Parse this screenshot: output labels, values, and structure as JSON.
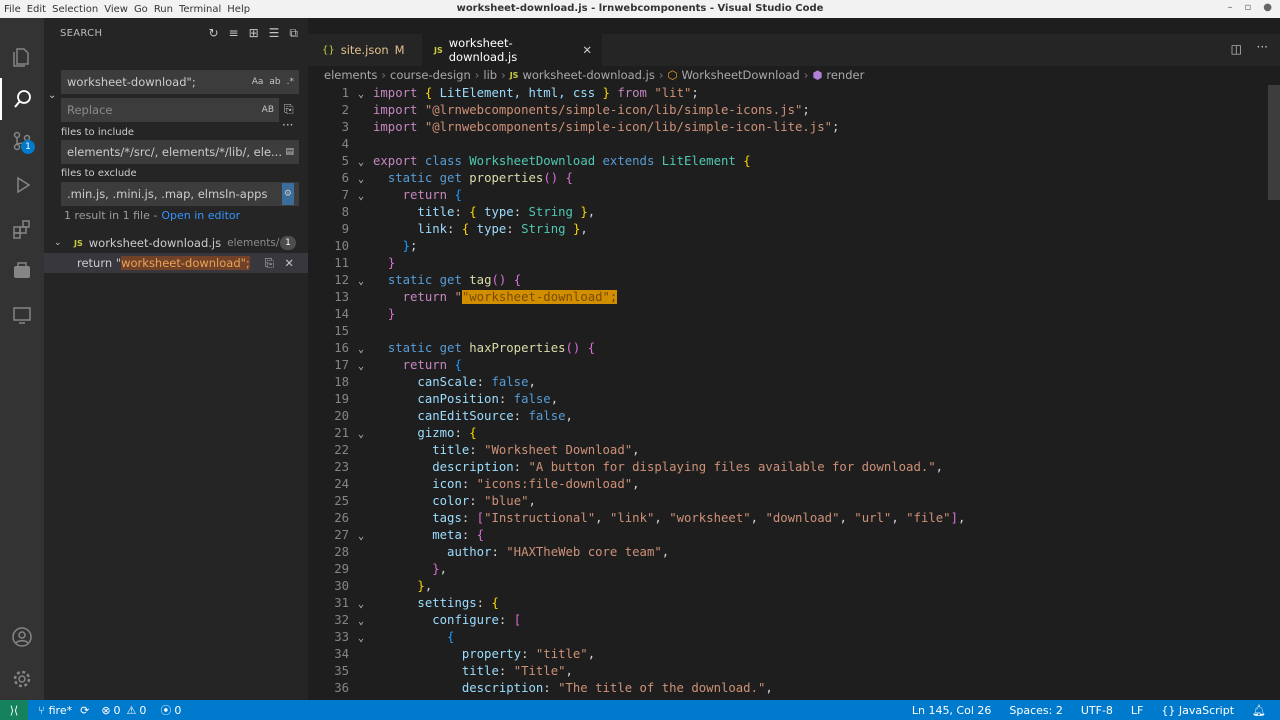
{
  "window": {
    "title": "worksheet-download.js - lrnwebcomponents - Visual Studio Code",
    "menu": [
      "File",
      "Edit",
      "Selection",
      "View",
      "Go",
      "Run",
      "Terminal",
      "Help"
    ]
  },
  "activity": {
    "scm_badge": "1"
  },
  "sidebar": {
    "header": "SEARCH",
    "search_value": "worksheet-download\";",
    "match_case": "Aa",
    "whole_word": "ab",
    "regex": ".*",
    "replace_placeholder": "Replace",
    "preserve_case": "AB",
    "include_label": "files to include",
    "include_value": "elements/*/src/, elements/*/lib/, ele...",
    "exclude_label": "files to exclude",
    "exclude_value": ".min.js, .mini.js, .map, elmsln-apps",
    "results_summary": "1 result in 1 file -",
    "open_in_editor": "Open in editor",
    "file_name": "worksheet-download.js",
    "file_path": "elements/...",
    "file_count": "1",
    "match_prefix": "return \"",
    "match_text": "worksheet-download\";"
  },
  "tabs": [
    {
      "icon": "{}",
      "label": "site.json",
      "status": "M"
    },
    {
      "icon": "JS",
      "label": "worksheet-download.js"
    }
  ],
  "breadcrumb": [
    "elements",
    "course-design",
    "lib",
    "worksheet-download.js",
    "WorksheetDownload",
    "render"
  ],
  "status": {
    "branch": "fire*",
    "errors": "0",
    "warnings": "0",
    "ports": "0",
    "position": "Ln 145, Col 26",
    "spaces": "Spaces: 2",
    "encoding": "UTF-8",
    "eol": "LF",
    "language": "JavaScript"
  },
  "code": {
    "l1_import": "import",
    "l1_names": "LitElement, html, css",
    "l1_from": "from",
    "l1_src": "\"lit\"",
    "l2_src": "\"@lrnwebcomponents/simple-icon/lib/simple-icons.js\"",
    "l3_src": "\"@lrnwebcomponents/simple-icon/lib/simple-icon-lite.js\"",
    "class_name": "WorksheetDownload",
    "extends_name": "LitElement",
    "type_name": "String",
    "tag_value": "\"worksheet-download\";",
    "gizmo_title": "\"Worksheet Download\"",
    "gizmo_description": "\"A button for displaying files available for download.\"",
    "gizmo_icon": "\"icons:file-download\"",
    "gizmo_color": "\"blue\"",
    "tags": [
      "\"Instructional\"",
      "\"link\"",
      "\"worksheet\"",
      "\"download\"",
      "\"url\"",
      "\"file\""
    ],
    "author": "\"HAXTheWeb core team\"",
    "prop_title": "\"title\"",
    "title_title": "\"Title\"",
    "title_description": "\"The title of the download.\""
  }
}
